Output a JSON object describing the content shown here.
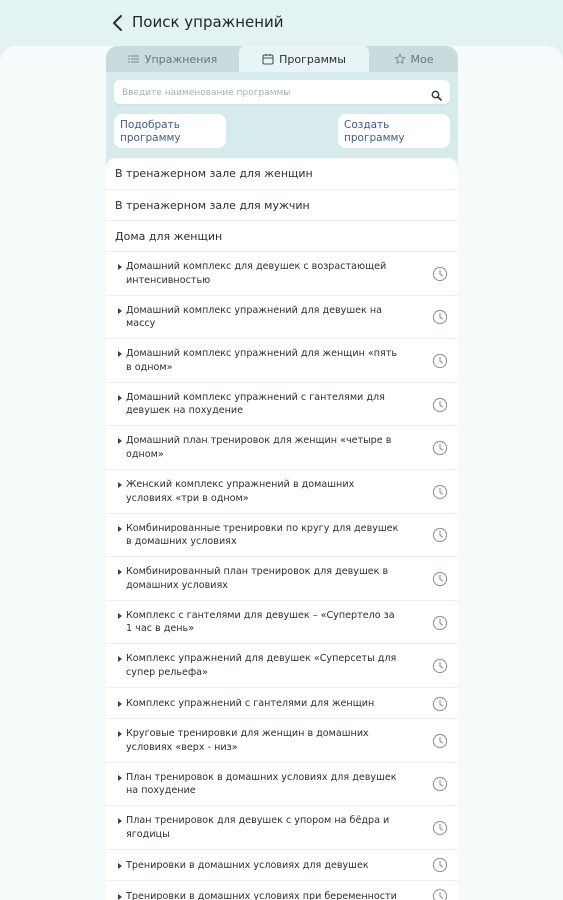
{
  "header": {
    "title": "Поиск упражнений"
  },
  "tabs": [
    {
      "label": "Упражнения",
      "icon": "list-icon",
      "active": false
    },
    {
      "label": "Программы",
      "icon": "calendar-icon",
      "active": true
    },
    {
      "label": "Мое",
      "icon": "star-icon",
      "active": false
    }
  ],
  "search": {
    "placeholder": "Введите наименование программы"
  },
  "buttons": {
    "pick": "Подобрать программу",
    "create": "Создать программу"
  },
  "categories": [
    "В тренажерном зале для женщин",
    "В тренажерном зале для мужчин",
    "Дома для женщин"
  ],
  "programs": [
    "Домашний комплекс для девушек с возрастающей интенсивностью",
    "Домашний комплекс упражнений для девушек на массу",
    "Домашний комплекс упражнений для женщин «пять в одном»",
    "Домашний комплекс упражнений с гантелями для девушек на похудение",
    "Домашний план тренировок для женщин «четыре в одном»",
    "Женский комплекс упражнений в домашних условиях «три в одном»",
    "Комбинированные тренировки по кругу для девушек в домашних условиях",
    "Комбинированный план тренировок для девушек в домашних условиях",
    "Комплекс с гантелями для девушек – «Супертело за 1 час в день»",
    "Комплекс упражнений для девушек «Суперсеты для супер рельефа»",
    "Комплекс упражнений с гантелями для женщин",
    "Круговые тренировки для женщин в домашних условиях «верх - низ»",
    "План тренировок в домашних условиях для девушек на похудение",
    "План тренировок для девушек с упором на бёдра и ягодицы",
    "Тренировки в домашних условиях для девушек",
    "Тренировки в домашних условиях при беременности"
  ],
  "colors": {
    "accent": "#3d5a9e",
    "background": "#e3f2f3",
    "panel": "#d7ebec"
  }
}
